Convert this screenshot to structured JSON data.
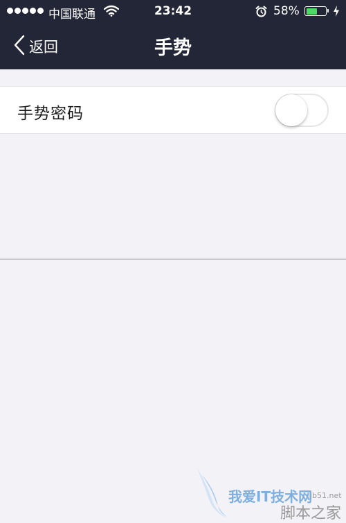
{
  "status_bar": {
    "carrier": "中国联通",
    "time": "23:42",
    "battery_percent": "58%",
    "battery_level": 0.58,
    "icons": [
      "signal-dots-icon",
      "wifi-icon",
      "alarm-icon",
      "battery-icon",
      "charging-bolt-icon"
    ]
  },
  "nav": {
    "back_label": "返回",
    "title": "手势"
  },
  "settings": {
    "gesture_password": {
      "label": "手势密码",
      "enabled": false
    }
  },
  "watermark": {
    "text1": "我爱IT技术网",
    "text2": "脚本之家",
    "domain": "jb51.net"
  },
  "colors": {
    "nav_background": "#222636",
    "page_background": "#f2f2f7",
    "battery_fill": "#4cd964"
  }
}
